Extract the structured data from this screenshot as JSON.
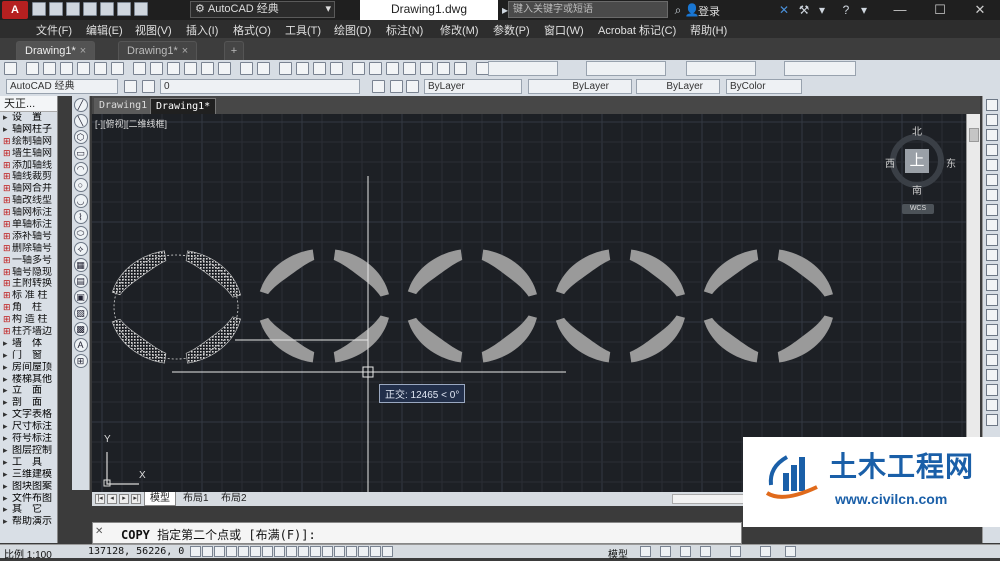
{
  "app": {
    "logo_text": "A",
    "workspace": "AutoCAD 经典",
    "doc_title": "Drawing1.dwg",
    "search_placeholder": "键入关键字或短语",
    "login": "登录"
  },
  "menu": [
    "文件(F)",
    "编辑(E)",
    "视图(V)",
    "插入(I)",
    "格式(O)",
    "工具(T)",
    "绘图(D)",
    "标注(N)",
    "修改(M)",
    "参数(P)",
    "窗口(W)",
    "Acrobat 标记(C)",
    "帮助(H)"
  ],
  "doc_tabs": [
    {
      "label": "Drawing1*",
      "active": true
    },
    {
      "label": "Drawing1*",
      "active": false
    }
  ],
  "toolbar2": {
    "workspace": "AutoCAD 经典",
    "layer": "0",
    "color": "ByLayer",
    "linetype": "ByLayer",
    "lineweight": "ByLayer",
    "plotstyle": "ByColor"
  },
  "left_panel": {
    "title": "天正...",
    "items": [
      {
        "label": "设　置",
        "section": true
      },
      {
        "label": "轴网柱子",
        "section": true
      },
      {
        "label": "绘制轴网"
      },
      {
        "label": "墙生轴网"
      },
      {
        "label": "添加轴线"
      },
      {
        "label": "轴线裁剪"
      },
      {
        "label": "轴网合并"
      },
      {
        "label": "轴改线型"
      },
      {
        "label": "轴网标注"
      },
      {
        "label": "单轴标注"
      },
      {
        "label": "添补轴号"
      },
      {
        "label": "删除轴号"
      },
      {
        "label": "一轴多号"
      },
      {
        "label": "轴号隐现"
      },
      {
        "label": "主附转换"
      },
      {
        "label": "标 准 柱"
      },
      {
        "label": "角　柱"
      },
      {
        "label": "构 造 柱"
      },
      {
        "label": "柱齐墙边"
      },
      {
        "label": "墙　体",
        "section": true
      },
      {
        "label": "门　窗",
        "section": true
      },
      {
        "label": "房间屋顶",
        "section": true
      },
      {
        "label": "楼梯其他",
        "section": true
      },
      {
        "label": "立　面",
        "section": true
      },
      {
        "label": "剖　面",
        "section": true
      },
      {
        "label": "文字表格",
        "section": true
      },
      {
        "label": "尺寸标注",
        "section": true
      },
      {
        "label": "符号标注",
        "section": true
      },
      {
        "label": "图层控制",
        "section": true
      },
      {
        "label": "工　具",
        "section": true
      },
      {
        "label": "三维建模",
        "section": true
      },
      {
        "label": "图块图案",
        "section": true
      },
      {
        "label": "文件布图",
        "section": true
      },
      {
        "label": "其　它",
        "section": true
      },
      {
        "label": "帮助演示",
        "section": true
      }
    ]
  },
  "canvas_tabs": [
    {
      "label": "Drawing1",
      "active": false
    },
    {
      "label": "Drawing1*",
      "active": true
    }
  ],
  "viewport_label": "[-][俯视][二维线框]",
  "viewcube": {
    "top": "上",
    "north": "北",
    "south": "南",
    "west": "西",
    "east": "东",
    "wcs": "WCS"
  },
  "tooltip": "正交: 12465 < 0°",
  "ucs": {
    "x": "X",
    "y": "Y"
  },
  "layout_tabs": [
    "模型",
    "布局1",
    "布局2"
  ],
  "command": {
    "name": "COPY",
    "prompt": "指定第二个点或 [布满(F)]:"
  },
  "status": {
    "scale": "比例 1:100",
    "coords": "137128, 56226, 0",
    "model": "模型"
  },
  "watermark": {
    "name": "土木工程网",
    "url": "www.civilcn.com"
  },
  "colors": {
    "canvas": "#1d2025",
    "chrome": "#3b3b3b",
    "panel": "#d9dfe6",
    "accent": "#b52020",
    "brand": "#1a5fa8"
  }
}
